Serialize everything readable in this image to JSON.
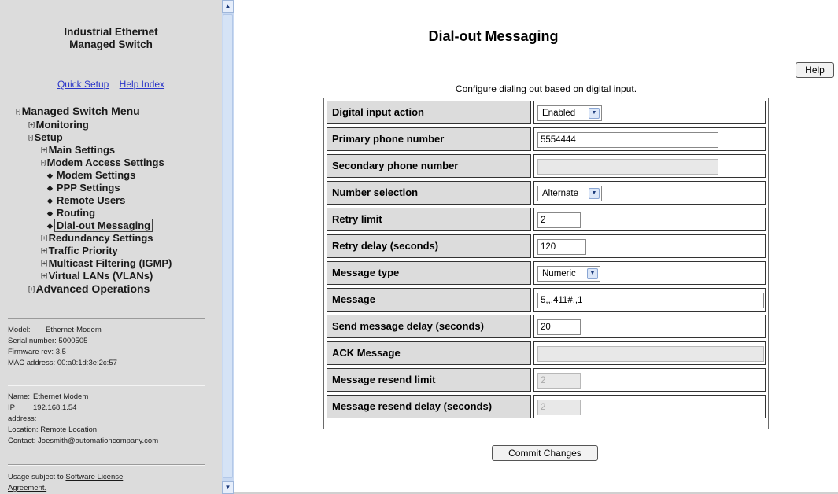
{
  "sidebar": {
    "title_line1": "Industrial Ethernet",
    "title_line2": "Managed Switch",
    "quick_setup": "Quick Setup",
    "help_index": "Help Index",
    "menu": {
      "managed_switch_menu": "Managed Switch Menu",
      "monitoring": "Monitoring",
      "setup": "Setup",
      "main_settings": "Main Settings",
      "modem_access_settings": "Modem Access Settings",
      "modem_settings": "Modem Settings",
      "ppp_settings": "PPP Settings",
      "remote_users": "Remote Users",
      "routing": "Routing",
      "dial_out_messaging": "Dial-out Messaging",
      "redundancy_settings": "Redundancy Settings",
      "traffic_priority": "Traffic Priority",
      "multicast_filtering": "Multicast Filtering (IGMP)",
      "virtual_lans": "Virtual LANs (VLANs)",
      "advanced_operations": "Advanced Operations",
      "toggle_open": "[-]",
      "toggle_closed": "[+]",
      "bullet": "◆"
    },
    "device": {
      "model_label": "Model:",
      "model": "Ethernet-Modem",
      "serial_label": "Serial number:",
      "serial": "5000505",
      "firmware_label": "Firmware rev:",
      "firmware": "3.5",
      "mac_label": "MAC address:",
      "mac": "00:a0:1d:3e:2c:57"
    },
    "contact": {
      "name_label": "Name:",
      "name": "Ethernet Modem",
      "ip_label": "IP",
      "ip": "192.168.1.54",
      "address_label": "address:",
      "location_label": "Location:",
      "location": "Remote Location",
      "contact_label": "Contact:",
      "contact": "Joesmith@automationcompany.com"
    },
    "license_prefix": "Usage subject to",
    "license_link_1": "Software License",
    "license_link_2": "Agreement."
  },
  "page": {
    "title": "Dial-out Messaging",
    "help": "Help",
    "subtitle": "Configure dialing out based on digital input.",
    "commit": "Commit Changes"
  },
  "form": {
    "digital_input_action": {
      "label": "Digital input action",
      "value": "Enabled"
    },
    "primary_phone": {
      "label": "Primary phone number",
      "value": "5554444"
    },
    "secondary_phone": {
      "label": "Secondary phone number",
      "value": ""
    },
    "number_selection": {
      "label": "Number selection",
      "value": "Alternate"
    },
    "retry_limit": {
      "label": "Retry limit",
      "value": "2"
    },
    "retry_delay": {
      "label": "Retry delay (seconds)",
      "value": "120"
    },
    "message_type": {
      "label": "Message type",
      "value": "Numeric"
    },
    "message": {
      "label": "Message",
      "value": "5,,,411#,,1"
    },
    "send_delay": {
      "label": "Send message delay (seconds)",
      "value": "20"
    },
    "ack_message": {
      "label": "ACK Message",
      "value": ""
    },
    "resend_limit": {
      "label": "Message resend limit",
      "value": "2"
    },
    "resend_delay": {
      "label": "Message resend delay (seconds)",
      "value": "2"
    }
  },
  "icons": {
    "dropdown": "chevron-down-icon",
    "scroll_up": "arrow-up-icon",
    "scroll_down": "arrow-down-icon"
  }
}
